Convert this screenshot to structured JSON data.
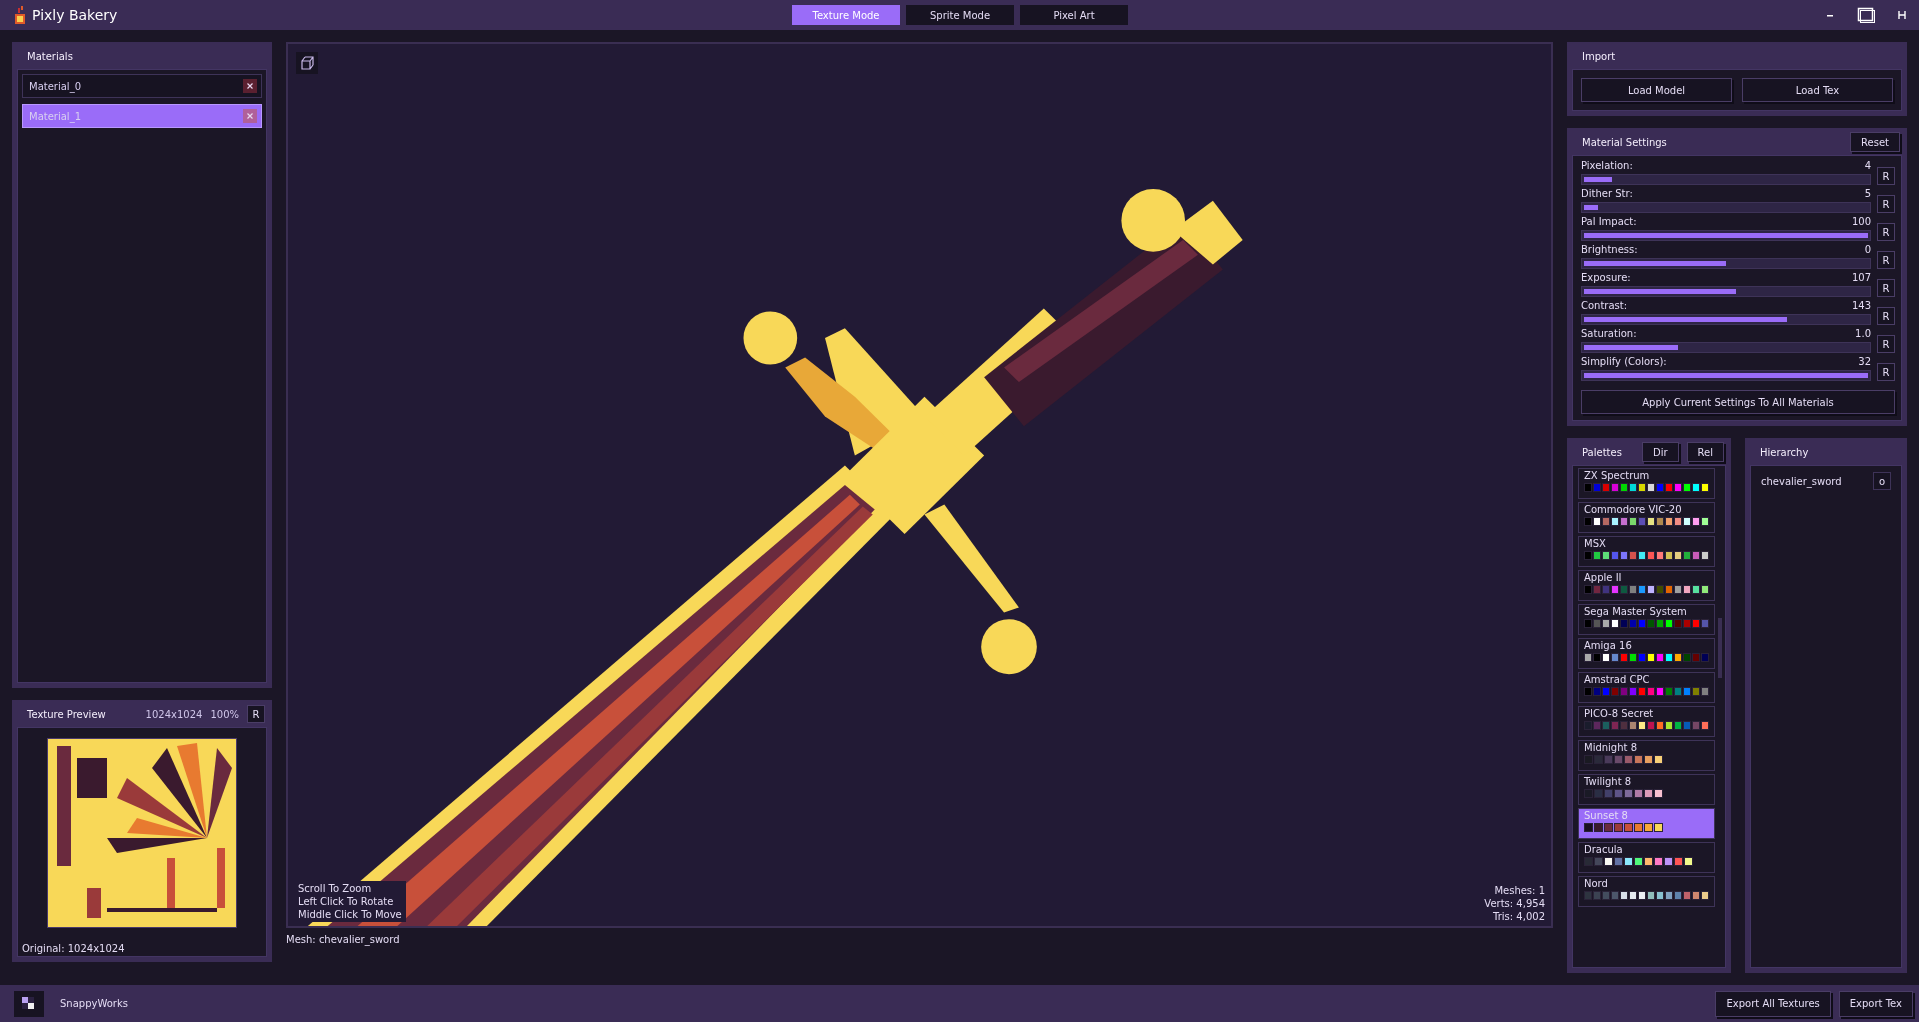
{
  "app": {
    "title": "Pixly Bakery"
  },
  "modes": [
    {
      "label": "Texture Mode",
      "selected": true
    },
    {
      "label": "Sprite Mode",
      "selected": false
    },
    {
      "label": "Pixel Art",
      "selected": false
    }
  ],
  "materials": {
    "title": "Materials",
    "items": [
      {
        "name": "Material_0",
        "selected": false
      },
      {
        "name": "Material_1",
        "selected": true
      }
    ]
  },
  "texture_preview": {
    "title": "Texture Preview",
    "size": "1024x1024",
    "zoom": "100%",
    "reset": "R",
    "original": "Original: 1024x1024"
  },
  "viewport": {
    "hints": [
      "Scroll To Zoom",
      "Left Click To Rotate",
      "Middle Click To Move"
    ],
    "stats": [
      "Meshes: 1",
      "Verts: 4,954",
      "Tris: 4,002"
    ],
    "mesh_label": "Mesh: chevalier_sword"
  },
  "import": {
    "title": "Import",
    "buttons": [
      "Load Model",
      "Load Tex"
    ]
  },
  "material_settings": {
    "title": "Material Settings",
    "reset": "Reset",
    "apply": "Apply Current Settings To All Materials",
    "sliders": [
      {
        "label": "Pixelation:",
        "value": "4",
        "level": 0.1,
        "reset": "R"
      },
      {
        "label": "Dither Str:",
        "value": "5",
        "level": 0.05,
        "reset": "R"
      },
      {
        "label": "Pal Impact:",
        "value": "100",
        "level": 1,
        "reset": "R"
      },
      {
        "label": "Brightness:",
        "value": "0",
        "level": 0.5,
        "reset": "R"
      },
      {
        "label": "Exposure:",
        "value": "107",
        "level": 0.535,
        "reset": "R"
      },
      {
        "label": "Contrast:",
        "value": "143",
        "level": 0.715,
        "reset": "R"
      },
      {
        "label": "Saturation:",
        "value": "1.0",
        "level": 0.33,
        "reset": "R"
      },
      {
        "label": "Simplify (Colors):",
        "value": "32",
        "level": 1,
        "reset": "R"
      }
    ]
  },
  "palettes": {
    "title": "Palettes",
    "buttons": [
      "Dir",
      "Rel"
    ],
    "items": [
      {
        "name": "ZX Spectrum",
        "selected": false,
        "colors": [
          {
            "color": "#000000"
          },
          {
            "color": "#0000d8"
          },
          {
            "color": "#d80000"
          },
          {
            "color": "#d800d8"
          },
          {
            "color": "#00d800"
          },
          {
            "color": "#00d8d8"
          },
          {
            "color": "#d8d800"
          },
          {
            "color": "#d8d8d8"
          },
          {
            "color": "#0000ff"
          },
          {
            "color": "#ff0000"
          },
          {
            "color": "#ff00ff"
          },
          {
            "color": "#00ff00"
          },
          {
            "color": "#00ffff"
          },
          {
            "color": "#ffff00"
          }
        ]
      },
      {
        "name": "Commodore VIC-20",
        "selected": false,
        "colors": [
          {
            "color": "#000000"
          },
          {
            "color": "#ffffff"
          },
          {
            "color": "#b66862"
          },
          {
            "color": "#a8f3ff"
          },
          {
            "color": "#c66fd0"
          },
          {
            "color": "#7ad86b"
          },
          {
            "color": "#5c4eb4"
          },
          {
            "color": "#e6e282"
          },
          {
            "color": "#b08a4e"
          },
          {
            "color": "#f2a16c"
          },
          {
            "color": "#f28c84"
          },
          {
            "color": "#d0ffff"
          },
          {
            "color": "#ff9ef0"
          },
          {
            "color": "#a0ff96"
          }
        ]
      },
      {
        "name": "MSX",
        "selected": false,
        "colors": [
          {
            "color": "#000000"
          },
          {
            "color": "#21c842"
          },
          {
            "color": "#5edc78"
          },
          {
            "color": "#5455ed"
          },
          {
            "color": "#7d76fc"
          },
          {
            "color": "#d4524d"
          },
          {
            "color": "#42ebf5"
          },
          {
            "color": "#fc5554"
          },
          {
            "color": "#ff7978"
          },
          {
            "color": "#d4c154"
          },
          {
            "color": "#e6ce80"
          },
          {
            "color": "#21b03b"
          },
          {
            "color": "#c95bba"
          },
          {
            "color": "#cccccc"
          }
        ]
      },
      {
        "name": "Apple II",
        "selected": false,
        "colors": [
          {
            "color": "#000000"
          },
          {
            "color": "#722640"
          },
          {
            "color": "#40337f"
          },
          {
            "color": "#e434fe"
          },
          {
            "color": "#0e5940"
          },
          {
            "color": "#808080"
          },
          {
            "color": "#1b9afe"
          },
          {
            "color": "#bfb3ff"
          },
          {
            "color": "#404c00"
          },
          {
            "color": "#e46501"
          },
          {
            "color": "#a0a0a0"
          },
          {
            "color": "#f1a6bf"
          },
          {
            "color": "#57e09f"
          },
          {
            "color": "#90ea7a"
          }
        ]
      },
      {
        "name": "Sega Master System",
        "selected": false,
        "colors": [
          {
            "color": "#000000"
          },
          {
            "color": "#555555"
          },
          {
            "color": "#aaaaaa"
          },
          {
            "color": "#ffffff"
          },
          {
            "color": "#000055"
          },
          {
            "color": "#0000aa"
          },
          {
            "color": "#0000ff"
          },
          {
            "color": "#005500"
          },
          {
            "color": "#00aa00"
          },
          {
            "color": "#00ff00"
          },
          {
            "color": "#550000"
          },
          {
            "color": "#aa0000"
          },
          {
            "color": "#ff0000"
          },
          {
            "color": "#5555aa"
          }
        ]
      },
      {
        "name": "Amiga 16",
        "selected": false,
        "colors": [
          {
            "color": "#aaaaaa"
          },
          {
            "color": "#000000"
          },
          {
            "color": "#ffffff"
          },
          {
            "color": "#6688cc"
          },
          {
            "color": "#ff0000"
          },
          {
            "color": "#00dd00"
          },
          {
            "color": "#0000ff"
          },
          {
            "color": "#ffff00"
          },
          {
            "color": "#ff00ff"
          },
          {
            "color": "#00ffff"
          },
          {
            "color": "#ffaa00"
          },
          {
            "color": "#004400"
          },
          {
            "color": "#660000"
          },
          {
            "color": "#000055"
          }
        ]
      },
      {
        "name": "Amstrad CPC",
        "selected": false,
        "colors": [
          {
            "color": "#000000"
          },
          {
            "color": "#000080"
          },
          {
            "color": "#0000ff"
          },
          {
            "color": "#800000"
          },
          {
            "color": "#800080"
          },
          {
            "color": "#8000ff"
          },
          {
            "color": "#ff0000"
          },
          {
            "color": "#ff0080"
          },
          {
            "color": "#ff00ff"
          },
          {
            "color": "#008000"
          },
          {
            "color": "#008080"
          },
          {
            "color": "#0080ff"
          },
          {
            "color": "#808000"
          },
          {
            "color": "#808080"
          }
        ]
      },
      {
        "name": "PICO-8 Secret",
        "selected": false,
        "colors": [
          {
            "color": "#1a1c2c"
          },
          {
            "color": "#5d275d"
          },
          {
            "color": "#1b5e5e"
          },
          {
            "color": "#7e2553"
          },
          {
            "color": "#4f2f3f"
          },
          {
            "color": "#ab8570"
          },
          {
            "color": "#ffec87"
          },
          {
            "color": "#be1250"
          },
          {
            "color": "#ff6c24"
          },
          {
            "color": "#a8e72e"
          },
          {
            "color": "#00b543"
          },
          {
            "color": "#065ab5"
          },
          {
            "color": "#754665"
          },
          {
            "color": "#ff6e59"
          }
        ]
      },
      {
        "name": "Midnight 8",
        "selected": false,
        "colors": [
          {
            "color": "#1a1a22"
          },
          {
            "color": "#2a2a3a"
          },
          {
            "color": "#4a3a5a"
          },
          {
            "color": "#6a4a6a"
          },
          {
            "color": "#9a5a6a"
          },
          {
            "color": "#c8765a"
          },
          {
            "color": "#e8a060"
          },
          {
            "color": "#f8d078"
          }
        ]
      },
      {
        "name": "Twilight 8",
        "selected": false,
        "colors": [
          {
            "color": "#1a1a26"
          },
          {
            "color": "#2a2e44"
          },
          {
            "color": "#42406a"
          },
          {
            "color": "#5e5488"
          },
          {
            "color": "#7e6a9a"
          },
          {
            "color": "#b07aa6"
          },
          {
            "color": "#dc9ab8"
          },
          {
            "color": "#f8c0d0"
          }
        ]
      },
      {
        "name": "Sunset 8",
        "selected": true,
        "colors": [
          {
            "color": "#1a0f1f"
          },
          {
            "color": "#3a1a2e"
          },
          {
            "color": "#6a2a3e"
          },
          {
            "color": "#9a3a3a"
          },
          {
            "color": "#c8503a"
          },
          {
            "color": "#e87a30"
          },
          {
            "color": "#f8a838"
          },
          {
            "color": "#f8d858"
          }
        ]
      },
      {
        "name": "Dracula",
        "selected": false,
        "colors": [
          {
            "color": "#282a36"
          },
          {
            "color": "#44475a"
          },
          {
            "color": "#f8f8f2"
          },
          {
            "color": "#6272a4"
          },
          {
            "color": "#8be9fd"
          },
          {
            "color": "#50fa7b"
          },
          {
            "color": "#ffb86c"
          },
          {
            "color": "#ff79c6"
          },
          {
            "color": "#bd93f9"
          },
          {
            "color": "#ff5555"
          },
          {
            "color": "#f1fa8c"
          }
        ]
      },
      {
        "name": "Nord",
        "selected": false,
        "colors": [
          {
            "color": "#2e3440"
          },
          {
            "color": "#3b4252"
          },
          {
            "color": "#434c5e"
          },
          {
            "color": "#4c566a"
          },
          {
            "color": "#d8dee9"
          },
          {
            "color": "#e5e9f0"
          },
          {
            "color": "#eceff4"
          },
          {
            "color": "#8fbcbb"
          },
          {
            "color": "#88c0d0"
          },
          {
            "color": "#81a1c1"
          },
          {
            "color": "#5e81ac"
          },
          {
            "color": "#bf616a"
          },
          {
            "color": "#d08770"
          },
          {
            "color": "#ebcb8b"
          }
        ]
      }
    ]
  },
  "hierarchy": {
    "title": "Hierarchy",
    "items": [
      {
        "name": "chevalier_sword",
        "toggle": "o"
      }
    ]
  },
  "footer": {
    "brand": "SnappyWorks",
    "buttons": [
      "Export All Textures",
      "Export Tex"
    ]
  }
}
